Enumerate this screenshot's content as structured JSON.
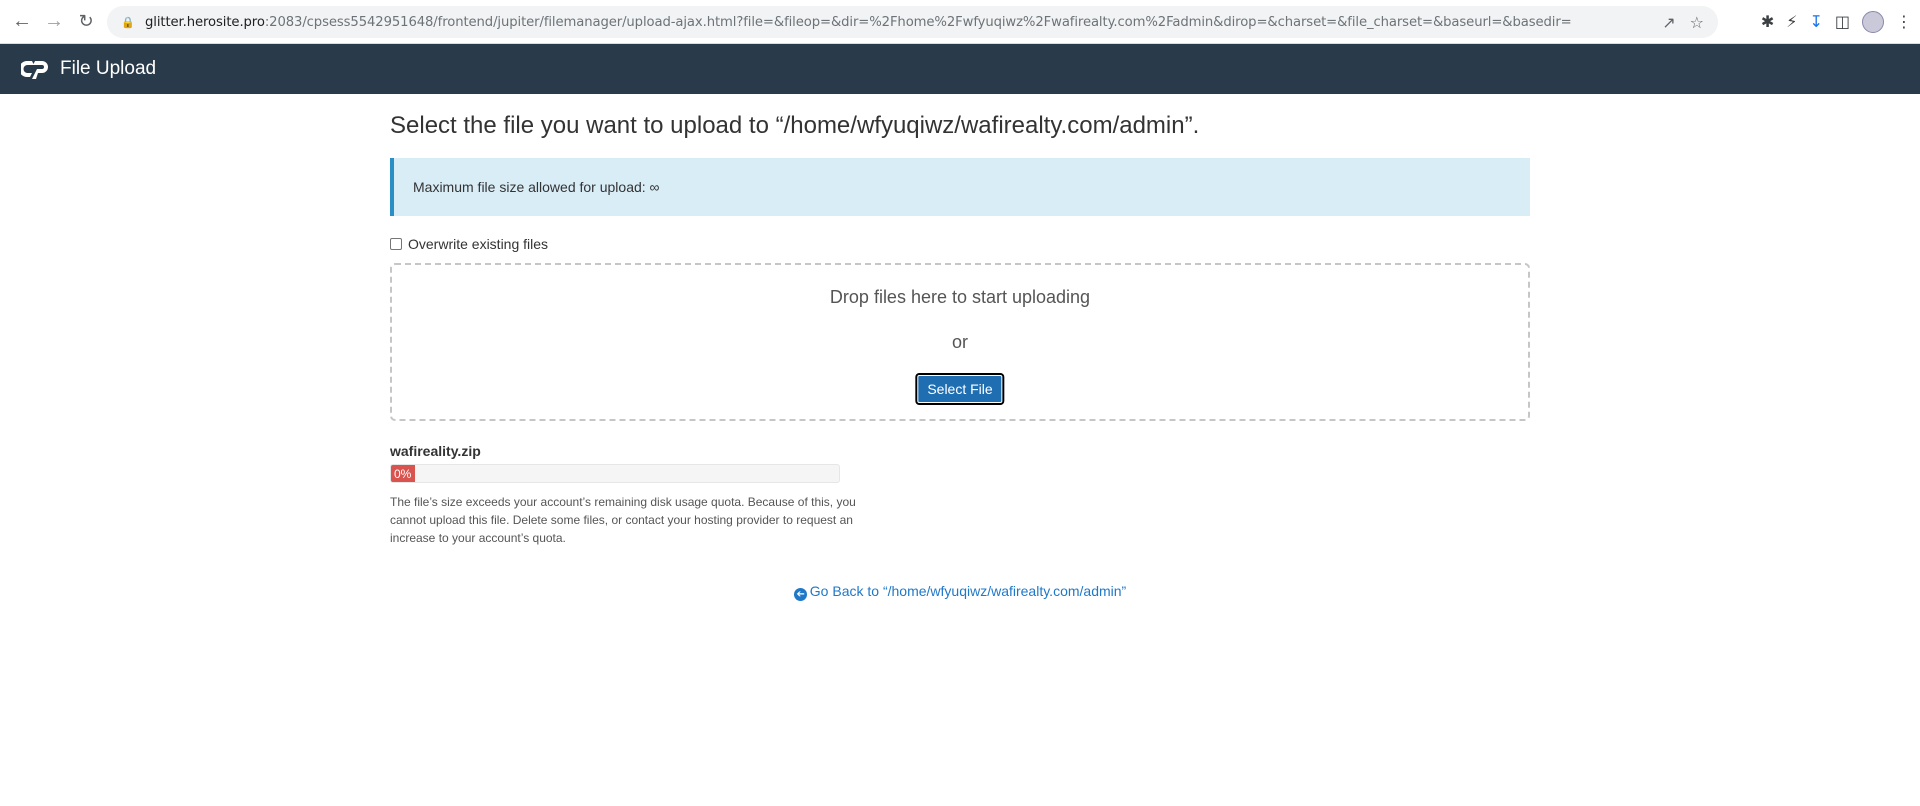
{
  "browser": {
    "url_host": "glitter.herosite.pro",
    "url_rest": ":2083/cpsess5542951648/frontend/jupiter/filemanager/upload-ajax.html?file=&fileop=&dir=%2Fhome%2Fwfyuqiwz%2Fwafirealty.com%2Fadmin&dirop=&charset=&file_charset=&baseurl=&basedir="
  },
  "header": {
    "title": "File Upload"
  },
  "main": {
    "title": "Select the file you want to upload to “/home/wfyuqiwz/wafirealty.com/admin”.",
    "max_size_label": "Maximum file size allowed for upload: ∞",
    "overwrite_label": "Overwrite existing files",
    "overwrite_checked": false,
    "dropzone_text": "Drop files here to start uploading",
    "dropzone_or": "or",
    "select_button": "Select File"
  },
  "upload": {
    "file_name": "wafireality.zip",
    "progress_label": "0%",
    "progress_percent": 0,
    "status_color": "#d9534f",
    "error": "The file’s size exceeds your account’s remaining disk usage quota. Because of this, you cannot upload this file. Delete some files, or contact your hosting provider to request an increase to your account’s quota."
  },
  "footer": {
    "go_back": "Go Back to “/home/wfyuqiwz/wafirealty.com/admin”"
  },
  "colors": {
    "header_bg": "#293a4a",
    "alert_bg": "#d9edf7",
    "button_bg": "#1f6eb2",
    "link": "#1f78c8"
  }
}
